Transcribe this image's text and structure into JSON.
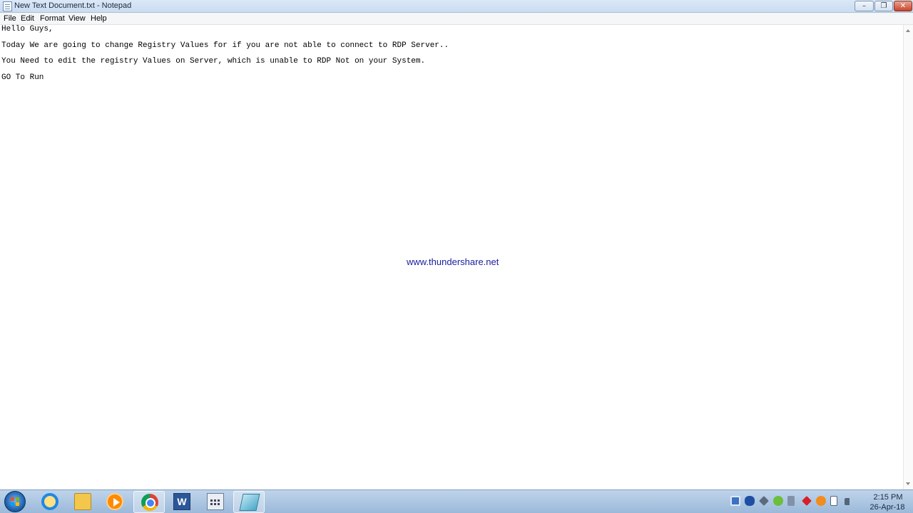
{
  "window": {
    "title": "New Text Document.txt - Notepad",
    "controls": {
      "minimize_icon": "minimize-icon",
      "maximize_icon": "restore-icon",
      "close_icon": "close-icon"
    }
  },
  "menu": {
    "items": [
      "File",
      "Edit",
      "Format",
      "View",
      "Help"
    ]
  },
  "editor": {
    "lines": [
      "Hello Guys,",
      "Today We are going to change Registry Values for if you are not able to connect to RDP Server..",
      "You Need to edit the registry Values on Server, which is unable to RDP Not on your System.",
      "GO To Run"
    ],
    "watermark": "www.thundershare.net"
  },
  "taskbar": {
    "start_icon": "windows-start-icon",
    "apps": [
      {
        "name": "internet-explorer-icon"
      },
      {
        "name": "file-explorer-icon"
      },
      {
        "name": "media-player-icon"
      },
      {
        "name": "chrome-icon"
      },
      {
        "name": "word-icon",
        "glyph": "W"
      },
      {
        "name": "calculator-icon"
      },
      {
        "name": "notepad-icon",
        "active": true
      }
    ],
    "tray_icons": [
      "display-icon",
      "bluetooth-icon",
      "network-device-icon",
      "utorrent-icon",
      "volume-icon",
      "antivirus-icon",
      "app-tray-icon",
      "action-center-flag-icon",
      "signal-icon"
    ],
    "clock": {
      "time": "2:15 PM",
      "date": "26-Apr-18"
    }
  },
  "colors": {
    "titlebar": "#c9dcf1",
    "taskbar": "#9bb9da",
    "watermark": "#1a1aa0",
    "close_button": "#c9432b"
  }
}
